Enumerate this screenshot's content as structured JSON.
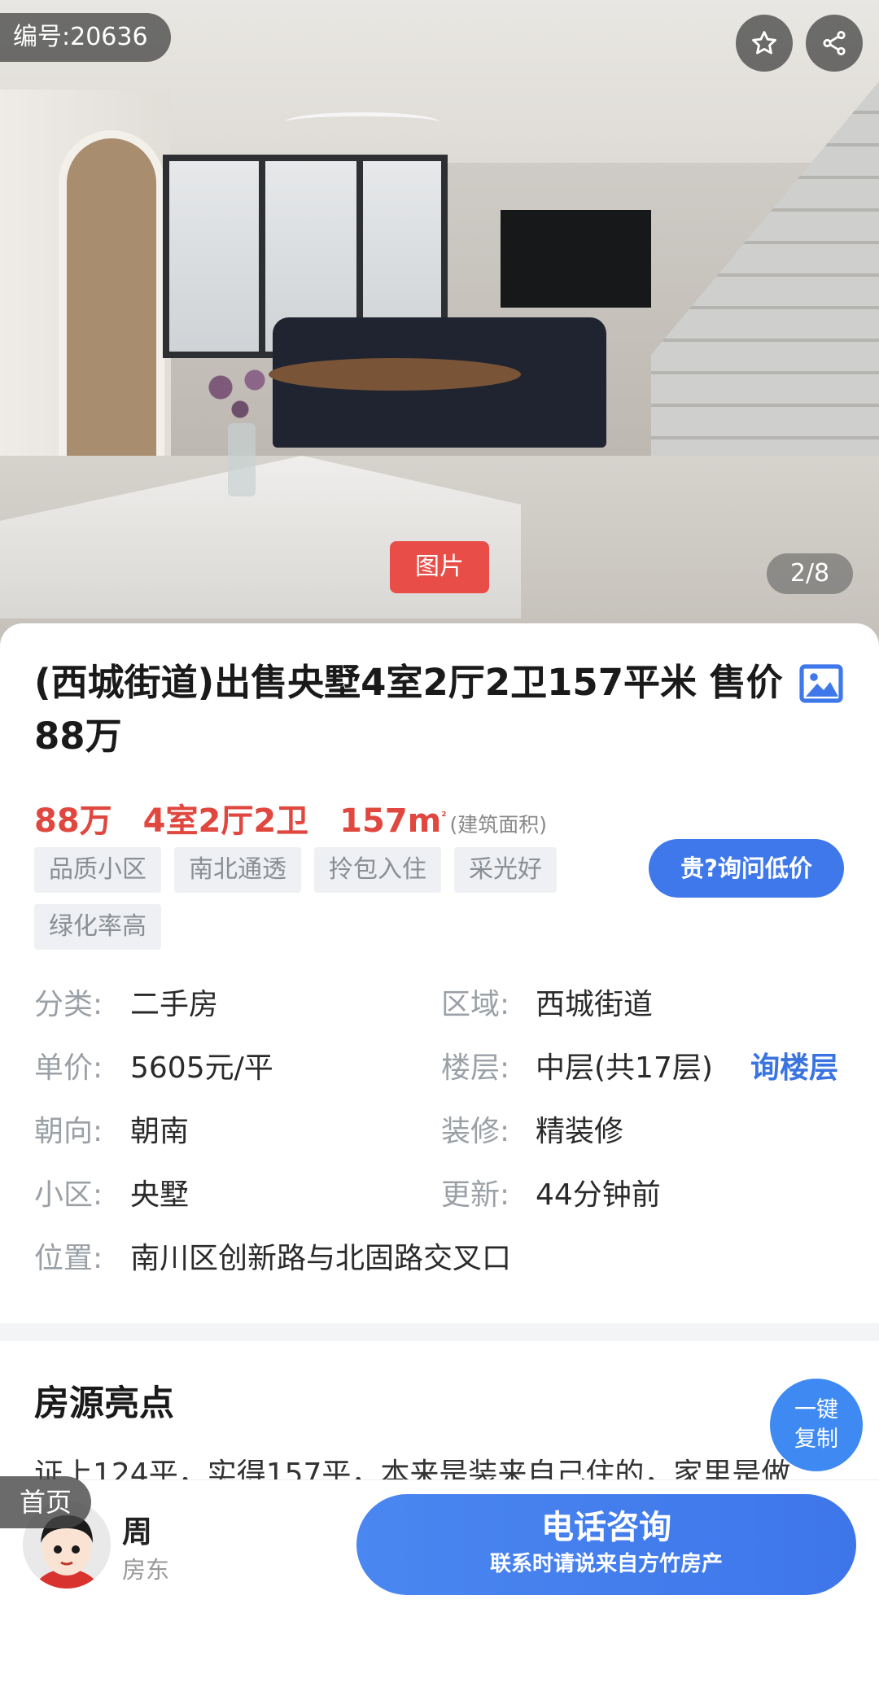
{
  "photo": {
    "listing_id": "编号:20636",
    "tag": "图片",
    "counter": "2/8"
  },
  "listing": {
    "title": "(西城街道)出售央墅4室2厅2卫157平米 售价88万",
    "price": "88万",
    "layout": "4室2厅2卫",
    "area": "157m",
    "area_unit_sup": "²",
    "area_note": "(建筑面积)",
    "tags": [
      "品质小区",
      "南北通透",
      "拎包入住",
      "采光好",
      "绿化率高"
    ],
    "ask_button": "贵?询问低价"
  },
  "info": {
    "category_label": "分类:",
    "category": "二手房",
    "region_label": "区域:",
    "region": "西城街道",
    "unit_price_label": "单价:",
    "unit_price": "5605元/平",
    "floor_label": "楼层:",
    "floor": "中层(共17层)",
    "floor_link": "询楼层",
    "orientation_label": "朝向:",
    "orientation": "朝南",
    "decoration_label": "装修:",
    "decoration": "精装修",
    "community_label": "小区:",
    "community": "央墅",
    "updated_label": "更新:",
    "updated": "44分钟前",
    "location_label": "位置:",
    "location": "南川区创新路与北固路交叉口"
  },
  "highlights": {
    "title": "房源亮点",
    "text": "证上124平，实得157平，本来是装来自己住的，家里是做",
    "copy_line1": "一键",
    "copy_line2": "复制"
  },
  "bottom": {
    "home": "首页",
    "owner_name": "周",
    "owner_role": "房东",
    "call_main": "电话咨询",
    "call_sub": "联系时请说来自方竹房产"
  },
  "colors": {
    "accent_blue": "#3f78ea",
    "price_red": "#e0473f",
    "photo_tag_red": "#e84e47"
  }
}
